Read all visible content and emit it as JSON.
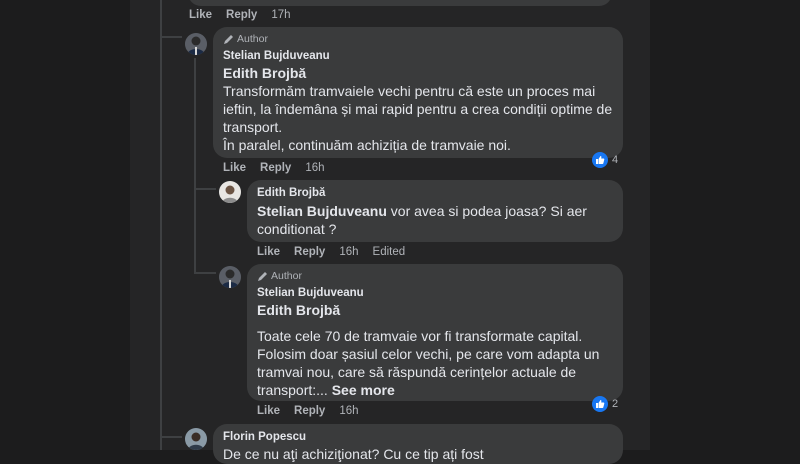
{
  "colors": {
    "accent": "#1877f2",
    "bubble": "#3a3b3c",
    "text": "#e4e6eb",
    "muted": "#b0b3b8"
  },
  "top_meta": {
    "like": "Like",
    "reply": "Reply",
    "time": "17h"
  },
  "comments": [
    {
      "badge": "Author",
      "author": "Stelian Bujduveanu",
      "mention": "Edith Brojbă",
      "lines": [
        "Transformăm tramvaiele vechi pentru că este un proces mai",
        "ieftin, la îndemâna și mai rapid pentru a crea condiții optime de",
        "transport.",
        "În paralel, continuăm achiziția de tramvaie noi."
      ],
      "like": "Like",
      "reply": "Reply",
      "time": "16h",
      "reactions": "4",
      "avatar_icon": "person-avatar-icon"
    },
    {
      "author": "Edith Brojbă",
      "mention": "Stelian Bujduveanu",
      "text_after_mention": " vor avea si podea joasa? Si aer",
      "line2": "conditionat ?",
      "like": "Like",
      "reply": "Reply",
      "time": "16h",
      "edited": "Edited",
      "avatar_icon": "person-avatar-icon"
    },
    {
      "badge": "Author",
      "author": "Stelian Bujduveanu",
      "mention": "Edith Brojbă",
      "lines": [
        "Toate cele 70 de tramvaie vor fi transformate capital.",
        "Folosim doar șasiul celor vechi, pe care vom adapta un",
        "tramvai nou, care să răspundă cerințelor actuale de",
        "transport:..."
      ],
      "see_more": "See more",
      "like": "Like",
      "reply": "Reply",
      "time": "16h",
      "reactions": "2",
      "avatar_icon": "person-avatar-icon"
    },
    {
      "author": "Florin Popescu",
      "partial_line": "De ce nu aţi achiziţionat? Cu ce tip ați fost ",
      "avatar_icon": "person-avatar-icon"
    }
  ]
}
